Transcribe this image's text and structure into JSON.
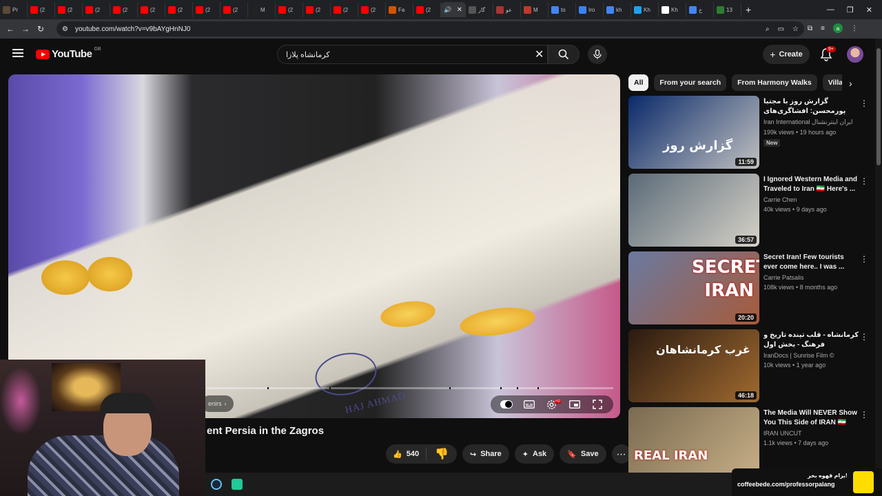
{
  "browser": {
    "tabs": [
      {
        "label": "Pr",
        "color": "#5b4a3a"
      },
      {
        "label": "(2",
        "color": "#ff0000"
      },
      {
        "label": "(2",
        "color": "#ff0000"
      },
      {
        "label": "(2",
        "color": "#ff0000"
      },
      {
        "label": "(2",
        "color": "#ff0000"
      },
      {
        "label": "(2",
        "color": "#ff0000"
      },
      {
        "label": "(2",
        "color": "#ff0000"
      },
      {
        "label": "(2",
        "color": "#ff0000"
      },
      {
        "label": "(2",
        "color": "#ff0000"
      },
      {
        "label": "M",
        "color": "#222222"
      },
      {
        "label": "(2",
        "color": "#ff0000"
      },
      {
        "label": "(2",
        "color": "#ff0000"
      },
      {
        "label": "(2",
        "color": "#ff0000"
      },
      {
        "label": "(2",
        "color": "#ff0000"
      },
      {
        "label": "Fa",
        "color": "#d35400"
      },
      {
        "label": "(2",
        "color": "#ff0000"
      }
    ],
    "active_tab_close": "✕",
    "tabs_after": [
      {
        "label": "گار",
        "color": "#555555"
      },
      {
        "label": "عو",
        "color": "#a33"
      },
      {
        "label": "M",
        "color": "#c0392b"
      },
      {
        "label": "to",
        "color": "#4285f4"
      },
      {
        "label": "Iro",
        "color": "#3b82f6"
      },
      {
        "label": "kh",
        "color": "#4285f4"
      },
      {
        "label": "Kh",
        "color": "#1da1f2"
      },
      {
        "label": "Kh",
        "color": "#ffffff"
      },
      {
        "label": "خ",
        "color": "#4285f4"
      },
      {
        "label": "13",
        "color": "#2e7d32"
      }
    ],
    "new_tab": "+",
    "window_controls": [
      "—",
      "❐",
      "✕"
    ],
    "url": "youtube.com/watch?v=v9bAYgHnNJ0",
    "profile_letter": "a"
  },
  "header": {
    "logo_text": "YouTube",
    "region": "GB",
    "search_query": "کرمانشاه پلازا",
    "create_label": "Create",
    "notifications": "9+"
  },
  "player": {
    "box_brand": "HAJ AHMAD",
    "chapter_chip": "enirs",
    "hd_badge": "HD"
  },
  "video": {
    "title_visible": "ent Persia in the Zagros",
    "like_count": "540",
    "share_label": "Share",
    "ask_label": "Ask",
    "save_label": "Save"
  },
  "chips": [
    "All",
    "From your search",
    "From Harmony Walks",
    "Villages"
  ],
  "recommendations": [
    {
      "title": "گزارش روز با مجتبا پورمحسن: افشاگری‌های تازه درباره مجتبی ...",
      "channel": "Iran International ایران اینترنشنال",
      "meta": "199k views • 19 hours ago",
      "badge": "New",
      "duration": "11:59",
      "thumb_text": "گزارش روز",
      "thumb_colors": [
        "#0a2a6a",
        "#c0c0c0"
      ]
    },
    {
      "title": "I Ignored Western Media and Traveled to Iran 🇮🇷 Here's ...",
      "channel": "Carrie Chen",
      "meta": "40k views • 9 days ago",
      "badge": "",
      "duration": "36:57",
      "thumb_text": "",
      "thumb_colors": [
        "#5a6a78",
        "#d6d2c8"
      ]
    },
    {
      "title": "Secret Iran!  Few tourists ever come here.. I was ...",
      "channel": "Carrie Patsalis",
      "meta": "108k views • 8 months ago",
      "badge": "",
      "duration": "20:20",
      "thumb_text": "SECRET IRAN",
      "thumb_colors": [
        "#6a7aa0",
        "#a85a3a"
      ]
    },
    {
      "title": "کرمانشاه - قلب تپنده تاریخ و فرهنگ - بخش اول",
      "channel": "IranDocs | Sunrise Film ©",
      "meta": "10k views • 1 year ago",
      "badge": "",
      "duration": "46:18",
      "thumb_text": "غرب کرمانشاهان",
      "thumb_colors": [
        "#2a1a10",
        "#a06a30"
      ]
    },
    {
      "title": "The Media Will NEVER Show You This Side of IRAN 🇮🇷",
      "channel": "IRAN UNCUT",
      "meta": "1.1k views • 7 days ago",
      "badge": "",
      "duration": "",
      "thumb_text": "REAL IRAN",
      "thumb_colors": [
        "#7a6a50",
        "#c8b088"
      ]
    }
  ],
  "coffee": {
    "fa_text": "برام قهوه بخر!",
    "url": "coffeebede.com/professorpalang"
  }
}
